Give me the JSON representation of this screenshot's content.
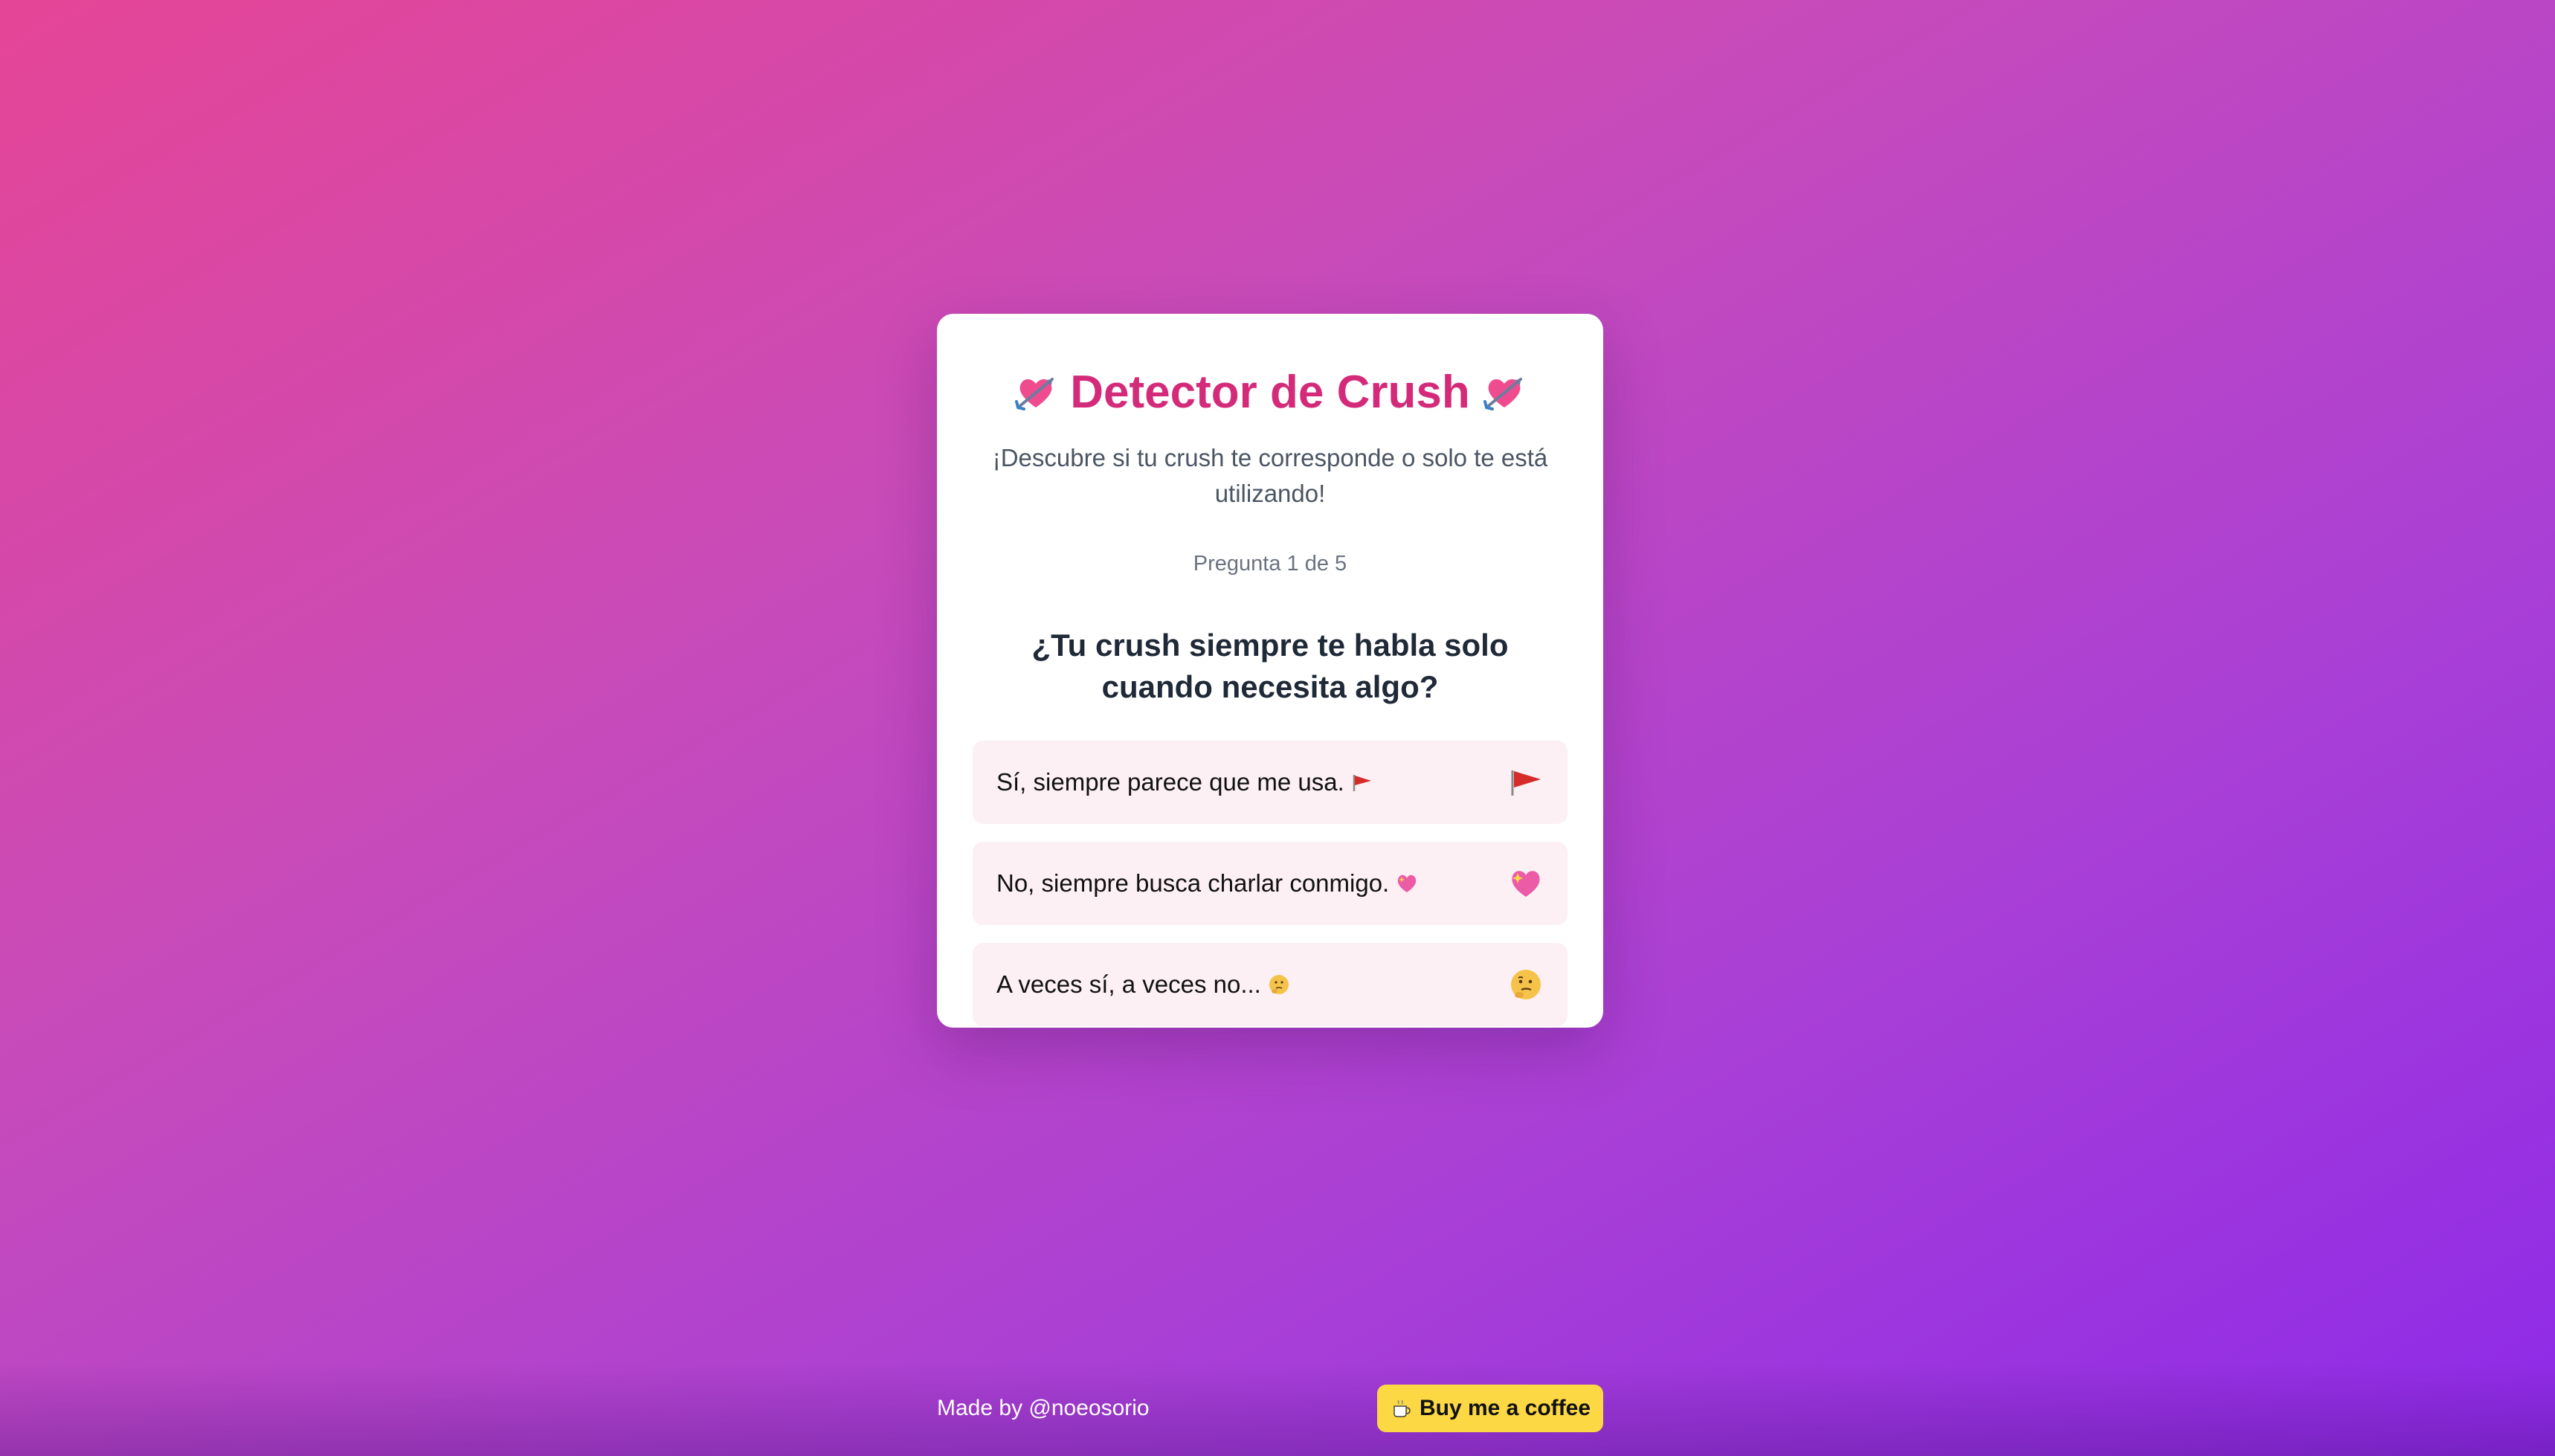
{
  "card": {
    "title": "Detector de Crush",
    "title_icon": "heart-with-arrow-icon",
    "subtitle": "¡Descubre si tu crush te corresponde o solo te está utilizando!",
    "progress": "Pregunta 1 de 5",
    "question": "¿Tu crush siempre te habla solo cuando necesita algo?",
    "options": [
      {
        "label": "Sí, siempre parece que me usa.",
        "icon": "red-flag-icon"
      },
      {
        "label": "No, siempre busca charlar conmigo.",
        "icon": "sparkling-heart-icon"
      },
      {
        "label": "A veces sí, a veces no...",
        "icon": "thinking-face-icon"
      }
    ]
  },
  "footer": {
    "made_by": "Made by @noeosorio",
    "coffee_label": "Buy me a coffee",
    "coffee_icon": "coffee-icon"
  },
  "colors": {
    "title": "#d42a7a",
    "option_bg": "#fcf0f4",
    "coffee_button": "#fcd844",
    "bg_start": "#e54596",
    "bg_end": "#8e2ae8"
  }
}
